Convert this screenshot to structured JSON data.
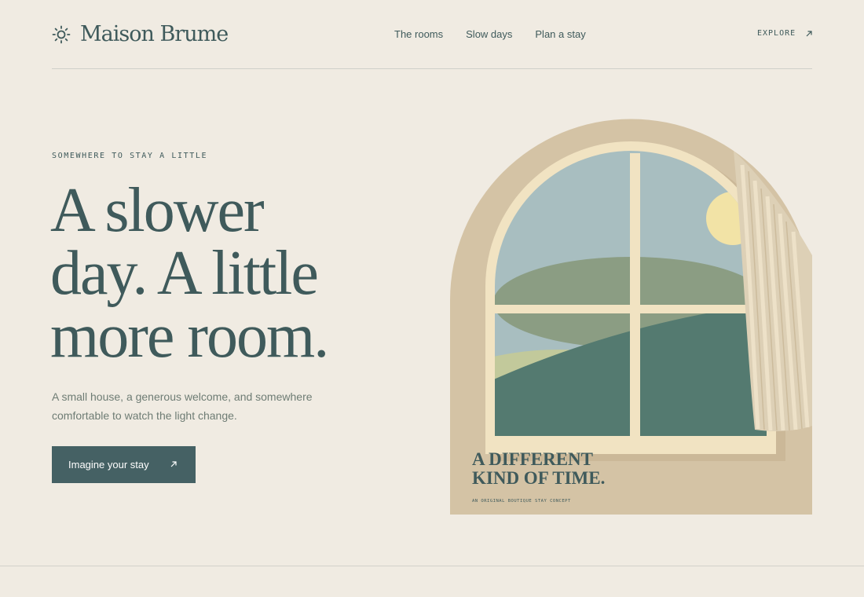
{
  "brand": {
    "name": "Maison Brume",
    "logo_icon": "sun-icon"
  },
  "nav": {
    "items": [
      {
        "label": "The rooms"
      },
      {
        "label": "Slow days"
      },
      {
        "label": "Plan a stay"
      }
    ]
  },
  "header": {
    "explore_label": "EXPLORE",
    "explore_icon": "arrow-up-right-icon"
  },
  "hero": {
    "eyebrow": "SOMEWHERE TO STAY A LITTLE",
    "headline_lines": [
      "A slower",
      "day. A little",
      "more room."
    ],
    "lede": "A small house, a generous welcome, and somewhere comfortable to watch the light change.",
    "cta_label": "Imagine your stay",
    "cta_icon": "arrow-up-right-icon"
  },
  "illustration": {
    "caption_lines": [
      "A DIFFERENT",
      "KIND OF TIME."
    ],
    "caption_small": "AN ORIGINAL BOUTIQUE STAY CONCEPT"
  },
  "colors": {
    "background": "#f0ebe2",
    "ink": "#3f5a5b",
    "button": "#456164",
    "arch": "#d4c3a5",
    "frame": "#f1e3c2",
    "sky": "#a8bec0",
    "hill_light": "#8b9d83",
    "hill_dark": "#547a70",
    "sun": "#f2e3a6"
  }
}
